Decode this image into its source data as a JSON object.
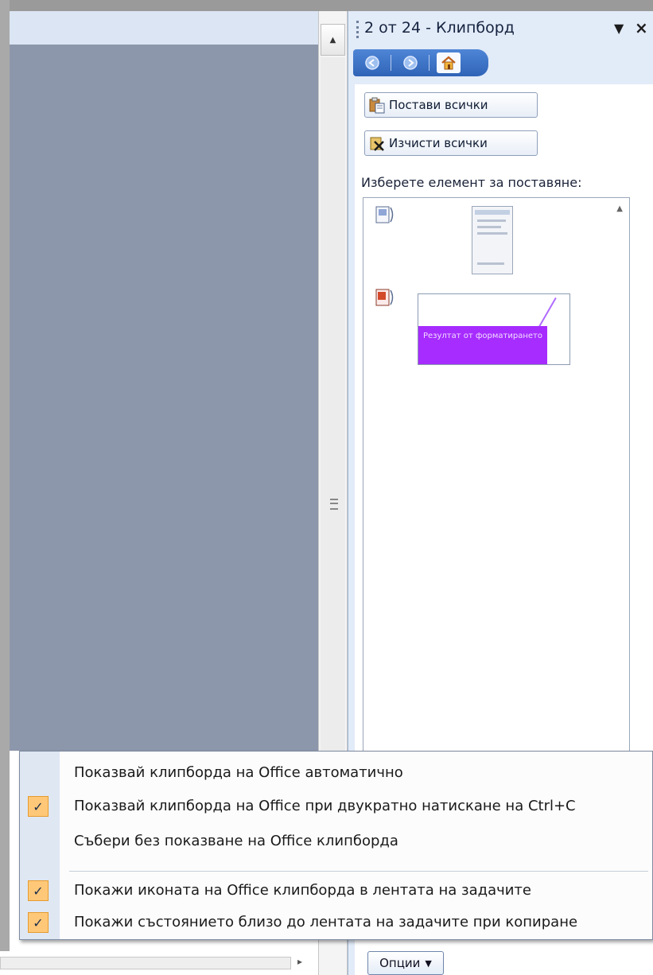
{
  "task_pane": {
    "title": "2 от 24 - Клипборд",
    "dropdown_icon": "triangle-down",
    "close_label": "×",
    "nav": {
      "back_icon": "back-arrow-icon",
      "forward_icon": "forward-arrow-icon",
      "home_icon": "home-icon"
    },
    "paste_all_label": "Постави всички",
    "clear_all_label": "Изчисти всички",
    "choose_label": "Изберете елемент за поставяне:",
    "items": [
      {
        "type": "image",
        "icon": "clipboard-item-icon"
      },
      {
        "type": "image",
        "icon": "clipboard-item-icon",
        "preview_text": "Резултат от форматирането"
      }
    ],
    "options_label": "Опции",
    "accent_color": "#2f63b7"
  },
  "options_menu": {
    "items": [
      {
        "label": "Показвай клипборда на Office автоматично",
        "checked": false
      },
      {
        "label": "Показвай клипборда на Office при двукратно натискане на Ctrl+C",
        "checked": true
      },
      {
        "label": "Събери без показване на Office клипборда",
        "checked": false
      },
      {
        "label": "Покажи иконата на Office клипборда в лентата на задачите",
        "checked": true
      },
      {
        "label": "Покажи състоянието близо до лентата на задачите при копиране",
        "checked": true
      }
    ]
  }
}
